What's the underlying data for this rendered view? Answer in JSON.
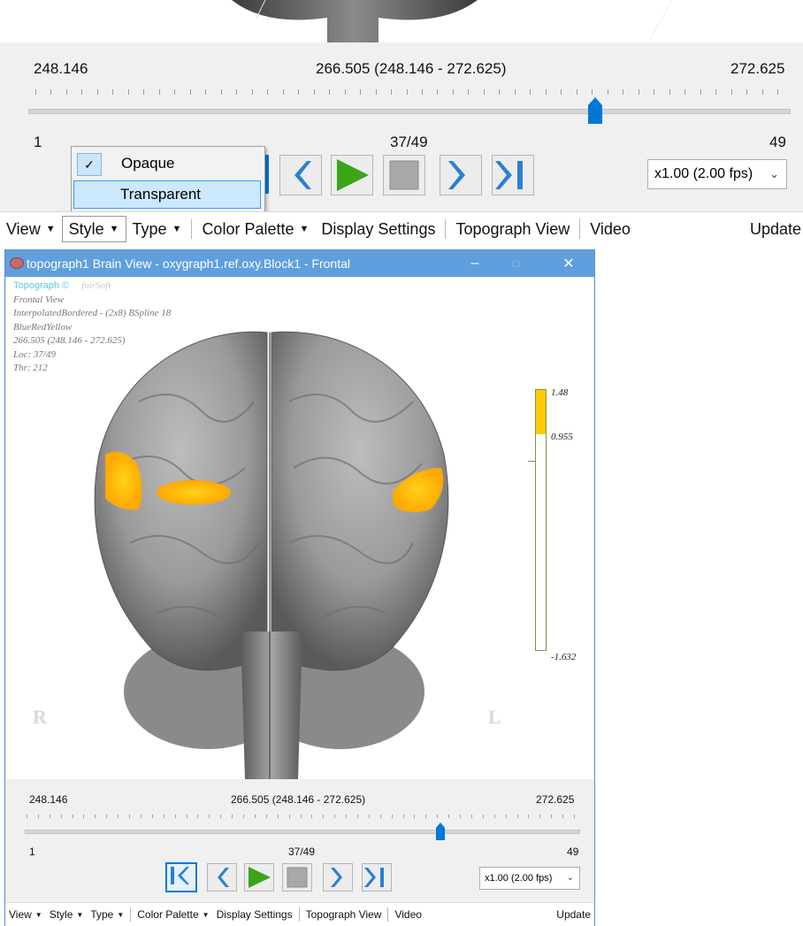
{
  "zoom_panel": {
    "range_min": "248.146",
    "range_center": "266.505 (248.146 - 272.625)",
    "range_max": "272.625",
    "frame_start": "1",
    "frame_current": "37/49",
    "frame_end": "49",
    "speed": "x1.00 (2.00 fps)"
  },
  "style_dropdown": {
    "options": [
      {
        "label": "Opaque",
        "checked": true
      },
      {
        "label": "Transparent",
        "highlighted": true
      }
    ]
  },
  "menubar": {
    "view": "View",
    "style": "Style",
    "type": "Type",
    "color_palette": "Color Palette",
    "display_settings": "Display Settings",
    "topograph_view": "Topograph View",
    "video": "Video",
    "update": "Update"
  },
  "window": {
    "title": "topograph1 Brain View - oxygraph1.ref.oxy.Block1 - Frontal",
    "minimize": "–",
    "maximize": "□",
    "close": "✕"
  },
  "overlay": {
    "brand": "Topograph ©",
    "vendor": "fnirSoft",
    "view_name": "Frontal View",
    "interpolation": "InterpolatedBordered - (2x8) BSpline 18",
    "palette": "BlueRedYellow",
    "range": "266.505 (248.146 - 272.625)",
    "loc": "Loc: 37/49",
    "thr": "Thr: 212",
    "right_label": "R",
    "left_label": "L"
  },
  "colorbar": {
    "max": "1.48",
    "threshold": "0.955",
    "min": "-1.632",
    "fill_fraction": 0.17,
    "fill_color": "#ffcc00"
  },
  "player": {
    "range_min": "248.146",
    "range_center": "266.505 (248.146 - 272.625)",
    "range_max": "272.625",
    "frame_start": "1",
    "frame_current": "37/49",
    "frame_end": "49",
    "speed": "x1.00 (2.00 fps)",
    "position_fraction": 0.75
  },
  "colors": {
    "accent": "#0078d7",
    "titlebar": "#5f9fde",
    "activation": "#ffc000"
  }
}
